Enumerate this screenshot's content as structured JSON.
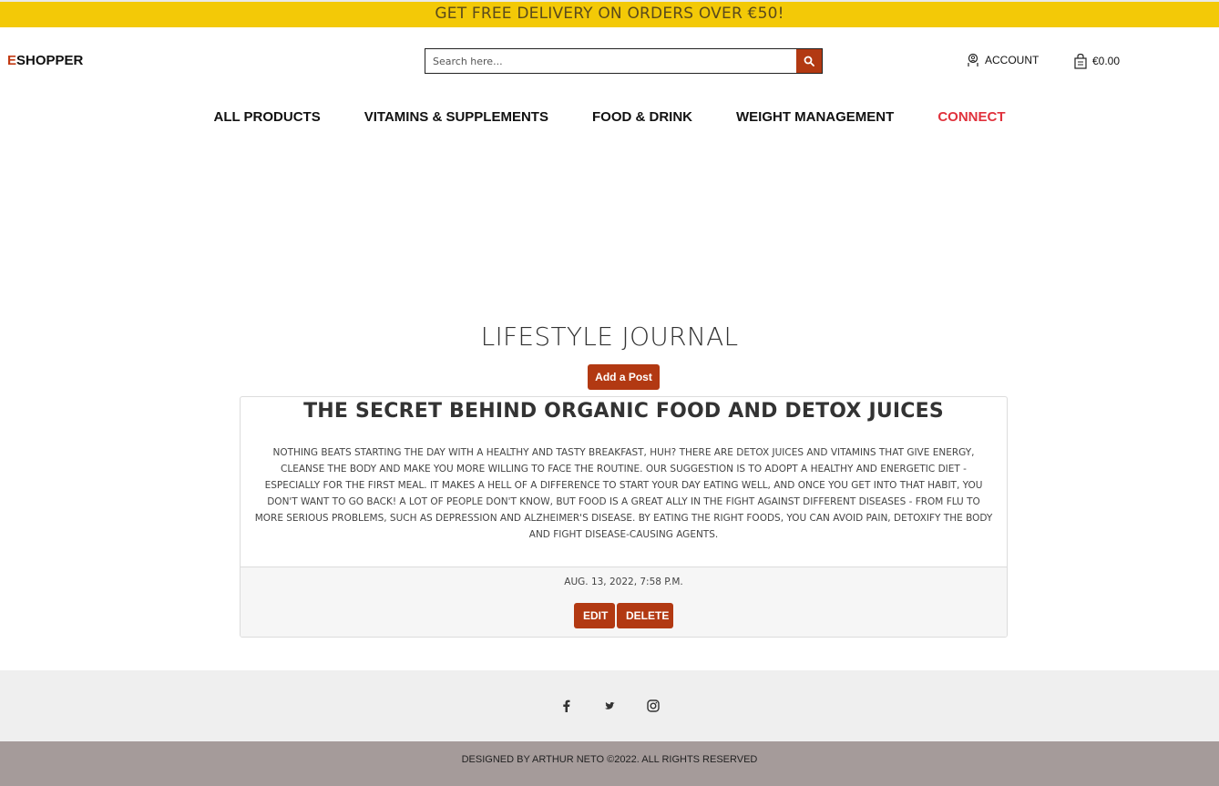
{
  "promo": {
    "text": "GET FREE DELIVERY ON ORDERS OVER €50!"
  },
  "brand": {
    "first_letter": "E",
    "rest": "SHOPPER"
  },
  "search": {
    "placeholder": "Search here..."
  },
  "header": {
    "account_label": "ACCOUNT",
    "cart_total": "€0.00"
  },
  "nav": {
    "items": [
      "ALL PRODUCTS",
      "VITAMINS & SUPPLEMENTS",
      "FOOD & DRINK",
      "WEIGHT MANAGEMENT",
      "CONNECT"
    ]
  },
  "page": {
    "title": "LIFESTYLE JOURNAL",
    "add_post_label": "Add a Post"
  },
  "post": {
    "title": "THE SECRET BEHIND ORGANIC FOOD AND DETOX JUICES",
    "body": "NOTHING BEATS STARTING THE DAY WITH A HEALTHY AND TASTY BREAKFAST, HUH? THERE ARE DETOX JUICES AND VITAMINS THAT GIVE ENERGY, CLEANSE THE BODY AND MAKE YOU MORE WILLING TO FACE THE ROUTINE. OUR SUGGESTION IS TO ADOPT A HEALTHY AND ENERGETIC DIET - ESPECIALLY FOR THE FIRST MEAL. IT MAKES A HELL OF A DIFFERENCE TO START YOUR DAY EATING WELL, AND ONCE YOU GET INTO THAT HABIT, YOU DON'T WANT TO GO BACK! A LOT OF PEOPLE DON'T KNOW, BUT FOOD IS A GREAT ALLY IN THE FIGHT AGAINST DIFFERENT DISEASES - FROM FLU TO MORE SERIOUS PROBLEMS, SUCH AS DEPRESSION AND ALZHEIMER'S DISEASE. BY EATING THE RIGHT FOODS, YOU CAN AVOID PAIN, DETOXIFY THE BODY AND FIGHT DISEASE-CAUSING AGENTS.",
    "date": "AUG. 13, 2022, 7:58 P.M.",
    "edit_label": "EDIT",
    "delete_label": "DELETE"
  },
  "social": {
    "icons": [
      "facebook-icon",
      "twitter-icon",
      "instagram-icon"
    ]
  },
  "footer": {
    "text": "DESIGNED BY ARTHUR NETO ©2022. ALL RIGHTS RESERVED"
  },
  "colors": {
    "promo_bg": "#f3c907",
    "accent": "#b23912",
    "connect": "#e0313c",
    "social_bg": "#efefef",
    "footer_bg": "#a59b9a"
  }
}
